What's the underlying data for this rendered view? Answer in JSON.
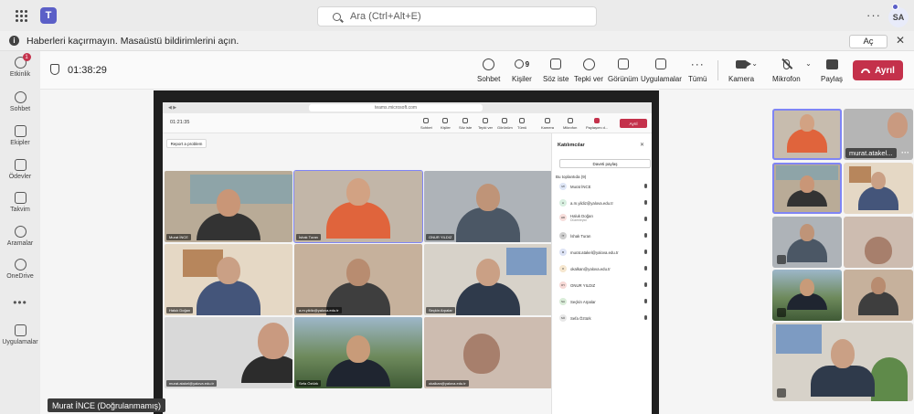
{
  "titlebar": {
    "search_placeholder": "Ara (Ctrl+Alt+E)",
    "more": "···",
    "user_initials": "SA"
  },
  "notification": {
    "message": "Haberleri kaçırmayın. Masaüstü bildirimlerini açın.",
    "action": "Aç",
    "close": "✕"
  },
  "rail": {
    "items": [
      {
        "label": "Etkinlik",
        "badge": "1"
      },
      {
        "label": "Sohbet"
      },
      {
        "label": "Ekipler"
      },
      {
        "label": "Ödevler"
      },
      {
        "label": "Takvim"
      },
      {
        "label": "Aramalar"
      },
      {
        "label": "OneDrive"
      },
      {
        "label": "Uygulamalar"
      }
    ],
    "more": "•••"
  },
  "meeting": {
    "timer": "01:38:29",
    "toolbar": [
      {
        "label": "Sohbet"
      },
      {
        "label": "Kişiler",
        "count": "9"
      },
      {
        "label": "Söz iste"
      },
      {
        "label": "Tepki ver"
      },
      {
        "label": "Görünüm"
      },
      {
        "label": "Uygulamalar"
      },
      {
        "label": "Tümü"
      },
      {
        "label": "Kamera"
      },
      {
        "label": "Mikrofon"
      },
      {
        "label": "Paylaş"
      }
    ],
    "leave": "Ayrıl"
  },
  "shared": {
    "url": "teams.microsoft.com",
    "timer": "01:21:35",
    "report": "Report a problem",
    "toolbar": [
      "Sohbet",
      "Kişiler",
      "Söz iste",
      "Tepki ver",
      "Görünüm",
      "Tümü",
      "Kamera",
      "Mikrofon",
      "Paylaşımı d..."
    ],
    "leave": "Ayrıl",
    "panel": {
      "title": "Katılımcılar",
      "invite": "Daveti paylaş",
      "section": "Bu toplantıda (9)",
      "participants": [
        {
          "initials": "Mİ",
          "name": "Murat İNCE",
          "color": "#dfe7f7"
        },
        {
          "initials": "A",
          "name": "a.m.yildiz@yalova.edu.tr",
          "color": "#d8efe0"
        },
        {
          "initials": "HD",
          "name": "Haluk Doğan",
          "sub": "Düzenleyici",
          "color": "#f7dedb"
        },
        {
          "initials": "İT",
          "name": "İshak Turan",
          "color": "#cfcfcf"
        },
        {
          "initials": "M",
          "name": "murat.atakel@yalova.edu.tr",
          "color": "#dde3f5"
        },
        {
          "initials": "O",
          "name": "okalkan@yalova.edu.tr",
          "color": "#f6e7cf"
        },
        {
          "initials": "OY",
          "name": "ONUR YILDIZ",
          "color": "#f7d9d6"
        },
        {
          "initials": "SA",
          "name": "Seçkin Arpalar",
          "color": "#d9ecd8"
        },
        {
          "initials": "SÖ",
          "name": "Sefa Öztürk",
          "color": "#e8e8e8"
        }
      ]
    },
    "tiles": [
      {
        "name": "Murat İNCE"
      },
      {
        "name": "İshak Turan"
      },
      {
        "name": "ONUR YILDIZ"
      },
      {
        "name": "Haluk Doğan"
      },
      {
        "name": "a.m.yildiz@yalova.edu.tr"
      },
      {
        "name": "Seçkin Arpalar"
      },
      {
        "name": "murat.atakel@yalova.edu.tr"
      },
      {
        "name": "Sefa Öztürk"
      },
      {
        "name": "okalkan@yalova.edu.tr"
      }
    ]
  },
  "right_tiles": {
    "label": "murat.atakel...",
    "more": "···"
  },
  "self_label": "Murat İNCE (Doğrulanmamış)"
}
